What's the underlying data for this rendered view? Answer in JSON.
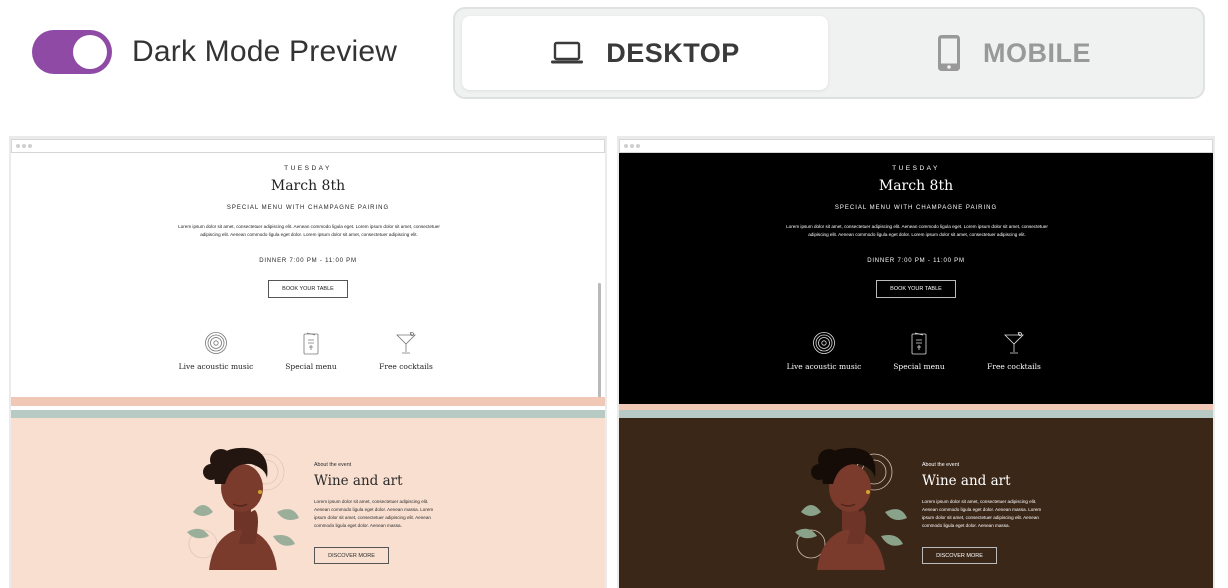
{
  "controls": {
    "dark_mode_label": "Dark Mode Preview",
    "dark_mode_on": true,
    "desktop_label": "DESKTOP",
    "mobile_label": "MOBILE",
    "selected_view": "desktop"
  },
  "icons": {
    "toggle_color": "#8f4aa6",
    "desktop_icon": "laptop-icon",
    "mobile_icon": "phone-icon",
    "feature_icons": [
      "vinyl-record-icon",
      "menu-card-icon",
      "cocktail-glass-icon"
    ]
  },
  "email": {
    "day": "TUESDAY",
    "date": "March 8th",
    "subtitle": "SPECIAL MENU WITH CHAMPAGNE PAIRING",
    "lorem": "Lorem ipsum dolor sit amet, consectetuer adipiscing elit. Aenean commodo ligula eget. Lorem ipsum dolor sit amet, consectetuer adipiscing elit. Aenean commodo ligula eget dolor. Lorem ipsum dolor sit amet, consectetuer adipiscing elit.",
    "time": "DINNER 7:00 PM - 11:00 PM",
    "cta": "BOOK YOUR TABLE",
    "features": [
      {
        "label": "Live acoustic music"
      },
      {
        "label": "Special menu"
      },
      {
        "label": "Free cocktails"
      }
    ],
    "about": {
      "eyebrow": "About the event",
      "title": "Wine and art",
      "text": "Lorem ipsum dolor sit amet, consectetuer adipiscing elit. Aenean commodo ligula eget dolor. Aenean massa. Lorem ipsum dolor sit amet, consectetuer adipiscing elit. Aenean commodo ligula eget dolor. Aenean massa.",
      "cta": "DISCOVER MORE"
    }
  },
  "colors": {
    "light_background": "#ffffff",
    "dark_background": "#000000",
    "light_about_background": "#f8dfd0",
    "dark_about_background": "#3b2718",
    "stripe_peach": "#f1c8b6",
    "stripe_sage": "#b7cac3"
  }
}
